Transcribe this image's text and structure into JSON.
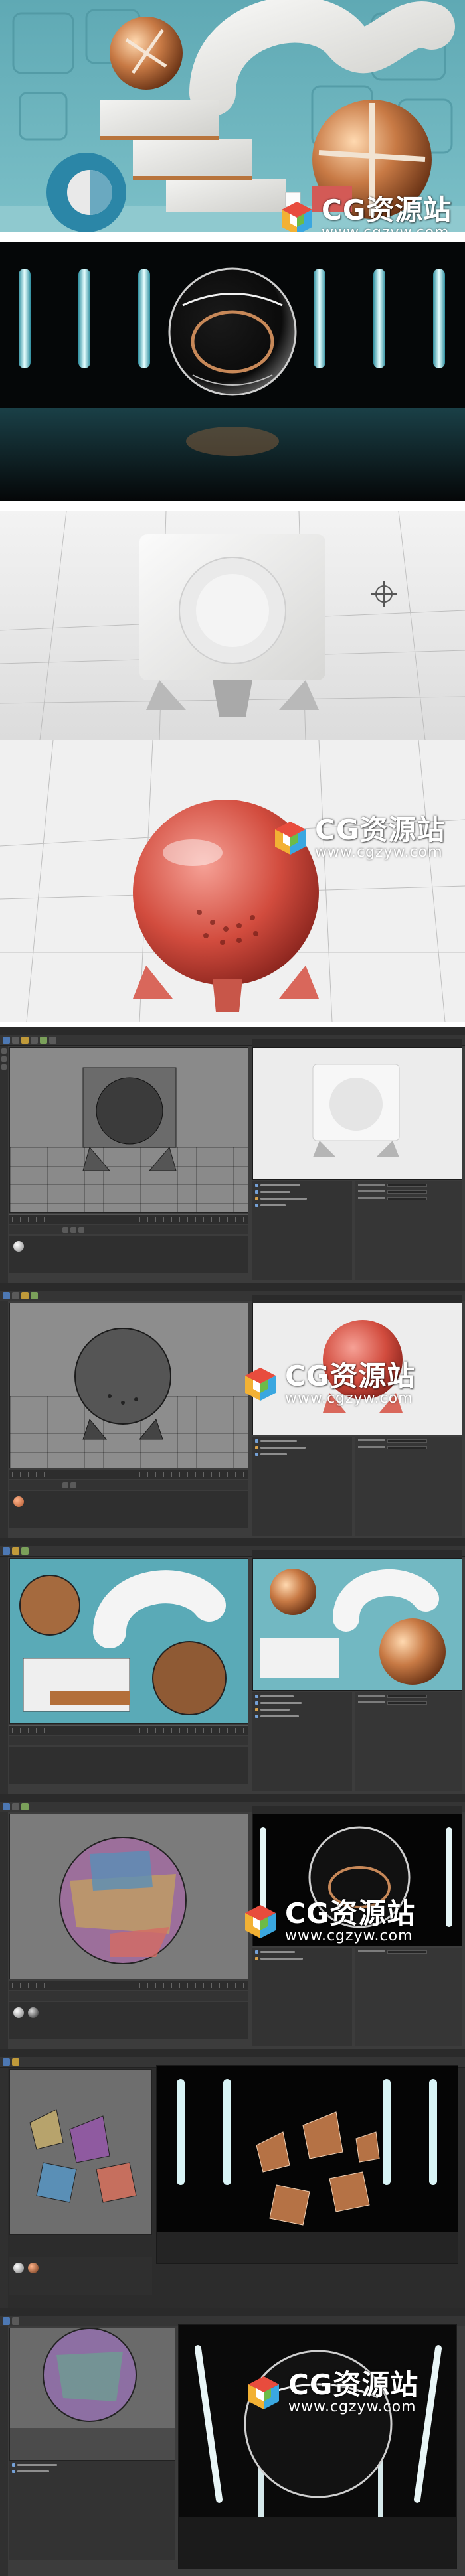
{
  "watermark": {
    "title": "CG资源站",
    "url": "www.cgzyw.com",
    "cube_colors": [
      "#e84c3d",
      "#f2b134",
      "#3aa7e0",
      "#6dbb47",
      "#ffffff"
    ]
  },
  "panels": [
    {
      "name": "render-abstract-tiles",
      "bg": "#6fb3bd"
    },
    {
      "name": "render-glass-sphere",
      "bg": "#050708"
    },
    {
      "name": "render-white-cube",
      "bg": "#e8e8e8"
    },
    {
      "name": "render-red-sphere",
      "bg": "#ededed"
    },
    {
      "name": "screenshot-c4d-white-cube",
      "bg": "#3c3c3c"
    },
    {
      "name": "screenshot-c4d-red-sphere",
      "bg": "#3c3c3c"
    },
    {
      "name": "screenshot-c4d-abstract-scene",
      "bg": "#3c3c3c"
    },
    {
      "name": "screenshot-c4d-uv-sphere",
      "bg": "#3c3c3c"
    },
    {
      "name": "screenshot-c4d-shattered",
      "bg": "#3c3c3c"
    },
    {
      "name": "screenshot-c4d-dark-sphere",
      "bg": "#3c3c3c"
    }
  ]
}
